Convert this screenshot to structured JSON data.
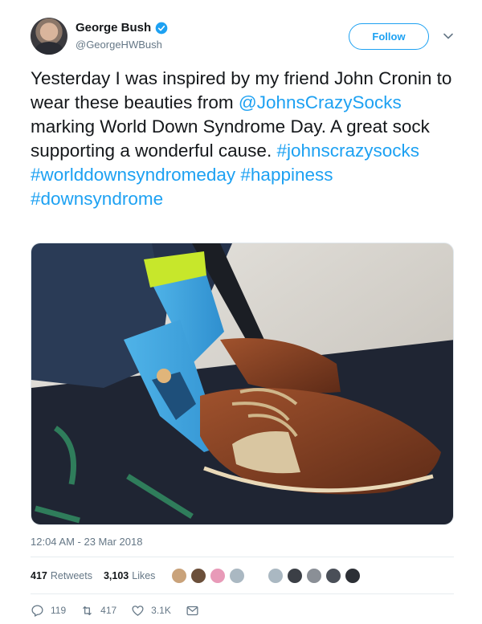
{
  "author": {
    "display_name": "George Bush",
    "handle": "@GeorgeHWBush",
    "verified": true,
    "verified_icon": "verified-badge-icon"
  },
  "follow_label": "Follow",
  "tweet": {
    "segments": [
      {
        "text": "Yesterday I was inspired by my friend John Cronin to wear these beauties from ",
        "link": false
      },
      {
        "text": "@JohnsCrazySocks",
        "link": true
      },
      {
        "text": " marking World Down Syndrome Day. A great sock supporting a wonderful cause. ",
        "link": false
      },
      {
        "text": "#johnscrazysocks",
        "link": true
      },
      {
        "text": " ",
        "link": false
      },
      {
        "text": "#worlddownsyndromeday",
        "link": true
      },
      {
        "text": " ",
        "link": false
      },
      {
        "text": "#happiness",
        "link": true
      },
      {
        "text": " ",
        "link": false
      },
      {
        "text": "#downsyndrome",
        "link": true
      }
    ],
    "link_color": "#1da1f2",
    "timestamp": "12:04 AM - 23 Mar 2018"
  },
  "stats": {
    "retweets_count": "417",
    "retweets_label": "Retweets",
    "likes_count": "3,103",
    "likes_label": "Likes",
    "liker_avatar_count": 10
  },
  "actions": {
    "reply_count": "119",
    "retweet_count": "417",
    "like_count": "3.1K",
    "icons": [
      "reply-icon",
      "retweet-icon",
      "like-icon",
      "direct-message-icon"
    ]
  },
  "colors": {
    "accent": "#1da1f2",
    "secondary_text": "#657786",
    "primary_text": "#14171a"
  }
}
